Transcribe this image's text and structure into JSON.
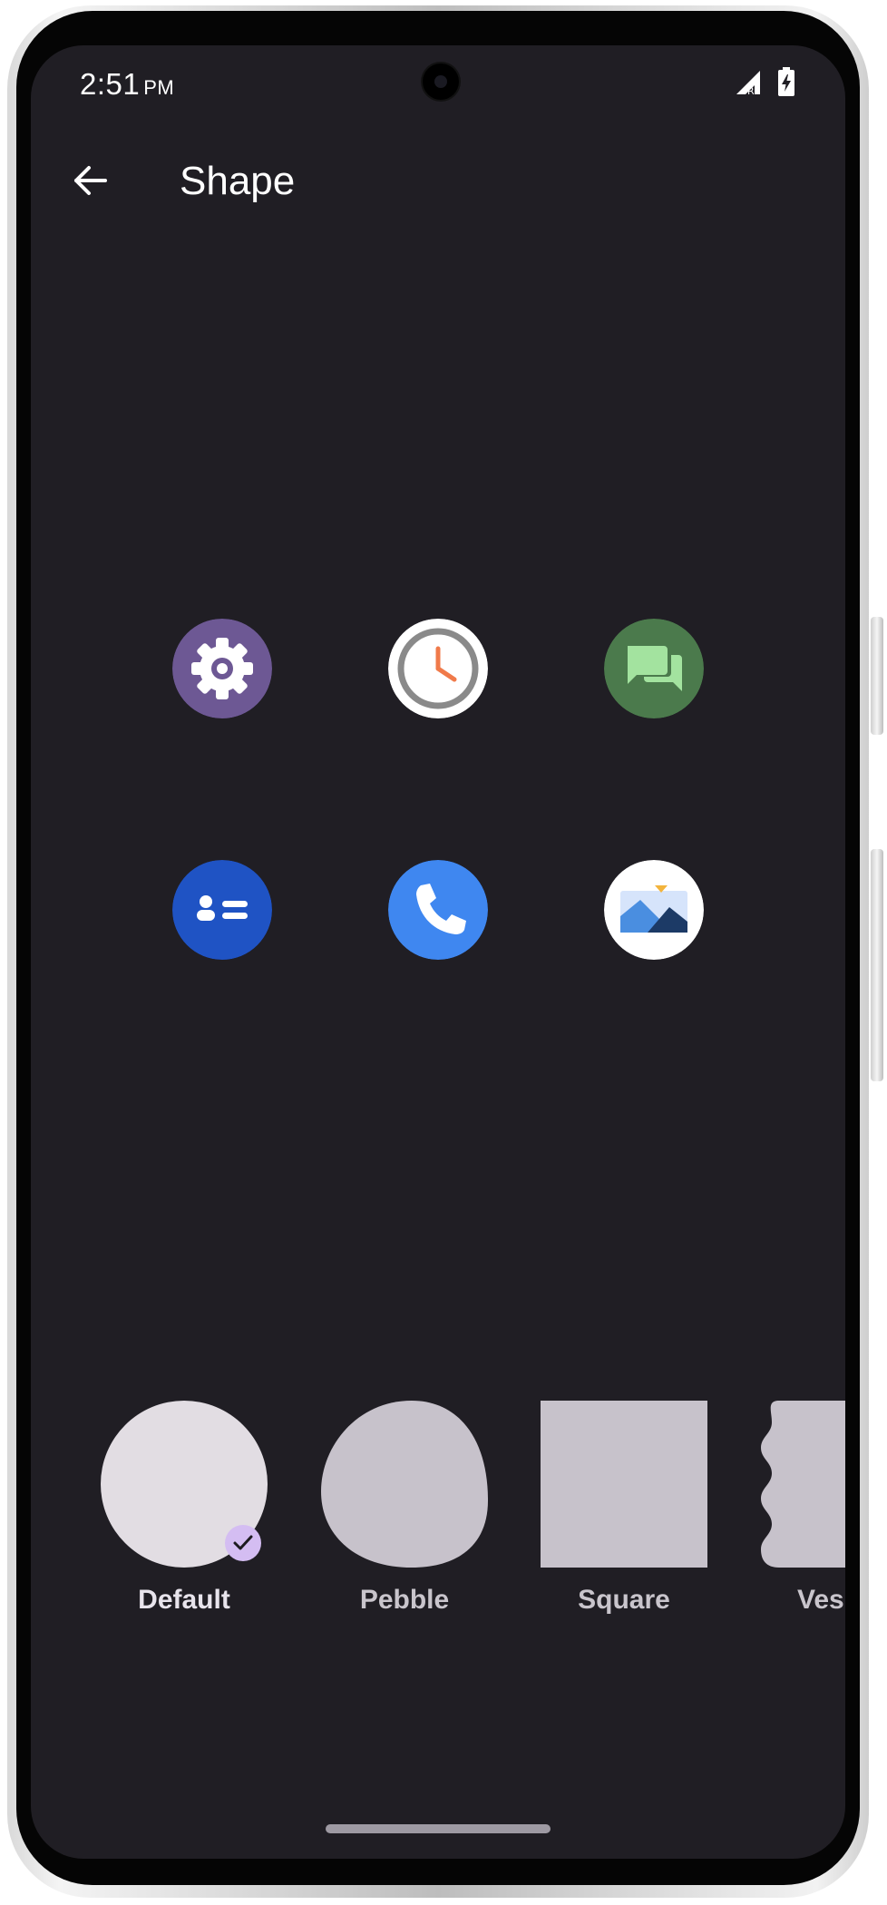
{
  "status_bar": {
    "time": "2:51",
    "ampm": "PM"
  },
  "app_bar": {
    "title": "Shape",
    "back_icon": "arrow-back-icon"
  },
  "preview_icons": [
    {
      "name": "settings-app-icon",
      "color": "#6d5894"
    },
    {
      "name": "clock-app-icon",
      "color": "#ffffff"
    },
    {
      "name": "messages-app-icon",
      "color": "#4b7a4c"
    },
    {
      "name": "contacts-app-icon",
      "color": "#1f53c4"
    },
    {
      "name": "phone-app-icon",
      "color": "#3f87f0"
    },
    {
      "name": "gallery-app-icon",
      "color": "#ffffff"
    }
  ],
  "shapes": [
    {
      "label": "Default",
      "selected": true
    },
    {
      "label": "Pebble",
      "selected": false
    },
    {
      "label": "Square",
      "selected": false
    },
    {
      "label": "Ves",
      "selected": false
    }
  ],
  "colors": {
    "background": "#201e24",
    "swatch_selected": "#e2dde3",
    "swatch": "#c7c2cb",
    "check_badge": "#d4bdf2"
  }
}
